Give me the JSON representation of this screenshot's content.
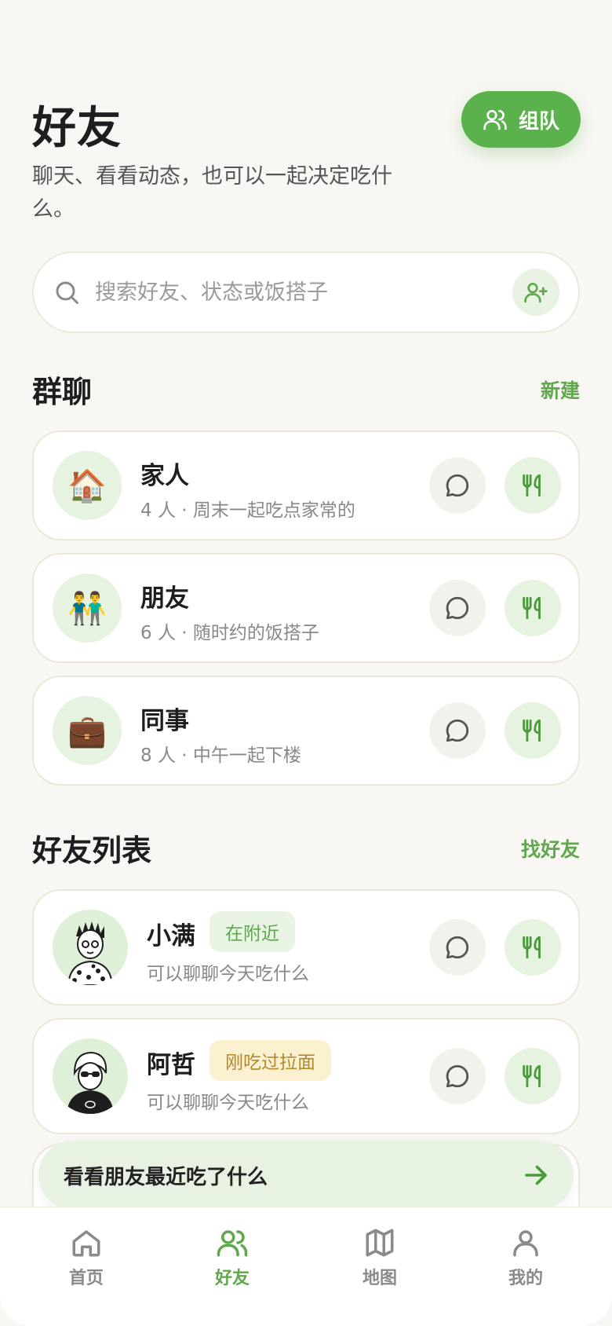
{
  "header": {
    "title": "好友",
    "subtitle": "聊天、看看动态，也可以一起决定吃什么。",
    "team_button": "组队"
  },
  "search": {
    "placeholder": "搜索好友、状态或饭搭子"
  },
  "groups_section": {
    "title": "群聊",
    "action": "新建",
    "items": [
      {
        "emoji": "🏠",
        "name": "家人",
        "desc": "4 人 · 周末一起吃点家常的"
      },
      {
        "emoji": "👬",
        "name": "朋友",
        "desc": "6 人 · 随时约的饭搭子"
      },
      {
        "emoji": "💼",
        "name": "同事",
        "desc": "8 人 · 中午一起下楼"
      }
    ]
  },
  "friends_section": {
    "title": "好友列表",
    "action": "找好友",
    "items": [
      {
        "name": "小满",
        "tag": "在附近",
        "tag_style": "green",
        "desc": "可以聊聊今天吃什么"
      },
      {
        "name": "阿哲",
        "tag": "刚吃过拉面",
        "tag_style": "yellow",
        "desc": "可以聊聊今天吃什么"
      }
    ]
  },
  "banner": {
    "text": "看看朋友最近吃了什么"
  },
  "bottom_nav": {
    "items": [
      {
        "label": "首页",
        "icon": "home-icon",
        "active": false
      },
      {
        "label": "好友",
        "icon": "friends-icon",
        "active": true
      },
      {
        "label": "地图",
        "icon": "map-icon",
        "active": false
      },
      {
        "label": "我的",
        "icon": "profile-icon",
        "active": false
      }
    ]
  },
  "colors": {
    "accent": "#5bb14b",
    "background": "#f8f7f3",
    "card_border": "#ede7d9"
  }
}
